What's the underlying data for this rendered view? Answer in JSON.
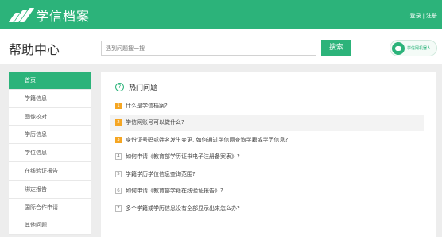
{
  "header": {
    "logo_text": "学信档案",
    "login": "登录",
    "separator": "|",
    "register": "注册"
  },
  "page_title": "帮助中心",
  "search": {
    "placeholder": "遇到问题搜一搜",
    "button": "搜索"
  },
  "robot": {
    "label": "学信网机器人"
  },
  "sidebar": {
    "items": [
      {
        "label": "首页"
      },
      {
        "label": "学籍信息"
      },
      {
        "label": "图像校对"
      },
      {
        "label": "学历信息"
      },
      {
        "label": "学位信息"
      },
      {
        "label": "在线验证报告"
      },
      {
        "label": "绑定报告"
      },
      {
        "label": "国际合作申请"
      },
      {
        "label": "其他问题"
      }
    ]
  },
  "hot": {
    "icon": "?",
    "title": "热门问题",
    "questions": [
      {
        "num": "1",
        "text": "什么是学信档案?"
      },
      {
        "num": "2",
        "text": "学信网账号可以做什么?"
      },
      {
        "num": "3",
        "text": "身份证号码或姓名发生变更, 如何通过学信网查询学籍或学历信息?"
      },
      {
        "num": "4",
        "text": "如何申请《教育部学历证书电子注册备案表》?"
      },
      {
        "num": "5",
        "text": "学籍学历学位信息查询范围?"
      },
      {
        "num": "6",
        "text": "如何申请《教育部学籍在线验证报告》?"
      },
      {
        "num": "7",
        "text": "多个学籍或学历信息没有全部显示出来怎么办?"
      }
    ]
  },
  "colors": {
    "brand": "#2cb37a",
    "hot_badge": "#f5a623"
  }
}
